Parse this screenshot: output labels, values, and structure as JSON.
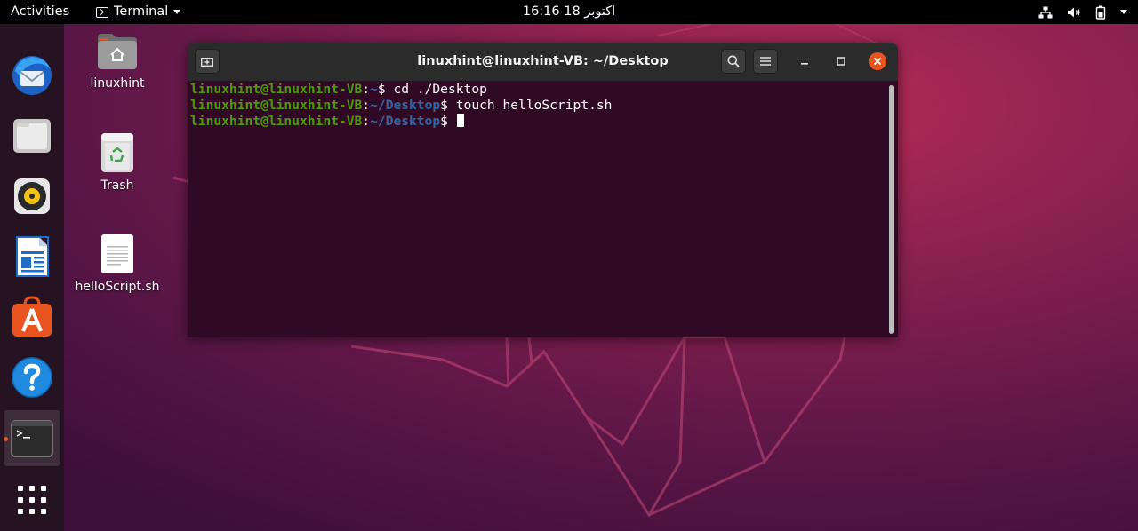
{
  "topbar": {
    "activities": "Activities",
    "app_name": "Terminal",
    "clock": "16:16  اکتوبر 18",
    "tray_icons": [
      "network-icon",
      "volume-icon",
      "battery-icon",
      "system-menu-caret-icon"
    ]
  },
  "dock": {
    "apps": [
      "Thunderbird Mail",
      "Files",
      "Rhythmbox",
      "LibreOffice Writer",
      "Ubuntu Software",
      "Help",
      "Terminal",
      "Show Applications"
    ],
    "active_app": "Terminal"
  },
  "desktop": {
    "icons": [
      {
        "label": "linuxhint",
        "icon": "home-folder-icon"
      },
      {
        "label": "Trash",
        "icon": "trash-icon"
      },
      {
        "label": "helloScript.sh",
        "icon": "text-file-icon"
      }
    ]
  },
  "terminal": {
    "title": "linuxhint@linuxhint-VB: ~/Desktop",
    "lines": [
      {
        "user": "linuxhint@linuxhint-VB",
        "sep": ":",
        "path": "~",
        "prompt": "$ ",
        "cmd": "cd ./Desktop"
      },
      {
        "user": "linuxhint@linuxhint-VB",
        "sep": ":",
        "path": "~/Desktop",
        "prompt": "$ ",
        "cmd": "touch helloScript.sh"
      },
      {
        "user": "linuxhint@linuxhint-VB",
        "sep": ":",
        "path": "~/Desktop",
        "prompt": "$ ",
        "cmd": ""
      }
    ]
  },
  "colors": {
    "topbar": "#000000",
    "dock": "#251321",
    "terminal_bg": "#300a24",
    "prompt_user": "#4e9a06",
    "prompt_path": "#3465a4",
    "close_button": "#e95420",
    "titlebar": "#2b2b2b"
  }
}
